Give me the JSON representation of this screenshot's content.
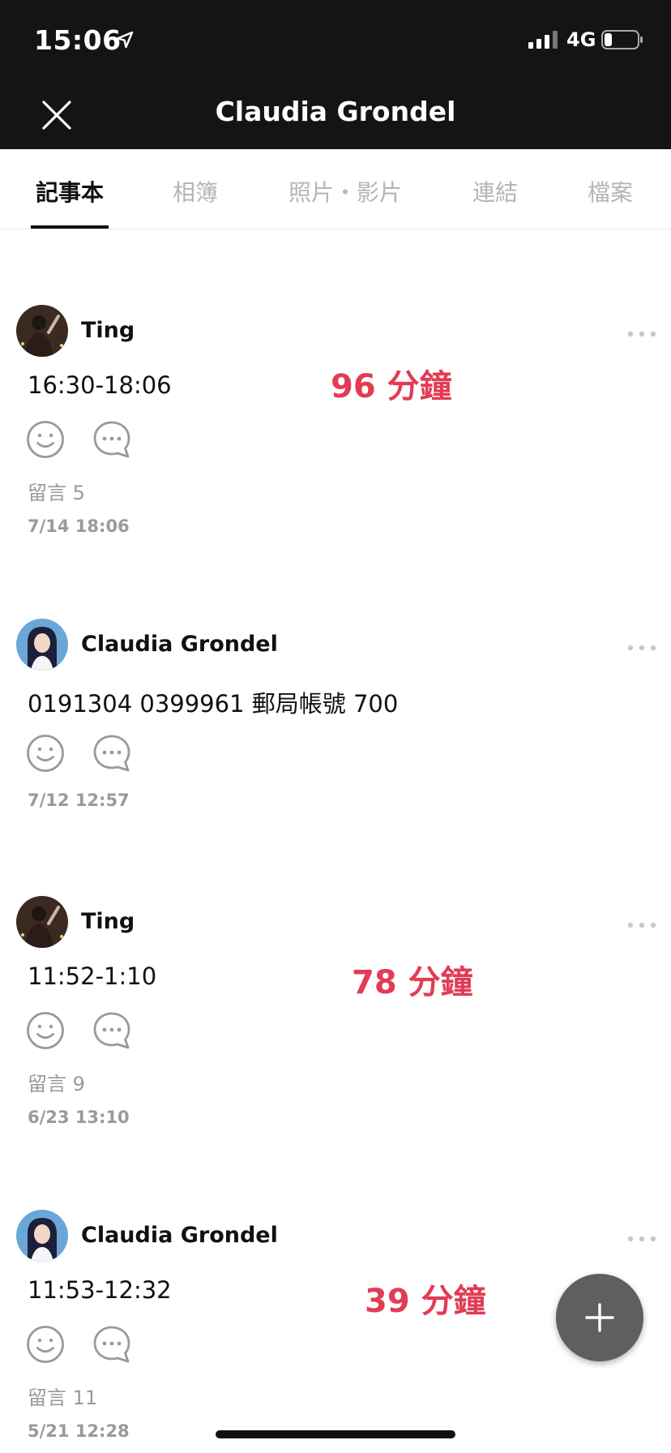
{
  "status_bar": {
    "time": "15:06",
    "network": "4G"
  },
  "header": {
    "title": "Claudia Grondel"
  },
  "tabs": [
    {
      "label": "記事本",
      "active": true
    },
    {
      "label": "相簿",
      "active": false
    },
    {
      "label": "照片・影片",
      "active": false
    },
    {
      "label": "連結",
      "active": false
    },
    {
      "label": "檔案",
      "active": false
    }
  ],
  "posts": [
    {
      "author": "Ting",
      "text": "16:30-18:06",
      "annotation": "96 分鐘",
      "comments": "留言 5",
      "timestamp": "7/14 18:06"
    },
    {
      "author": "Claudia Grondel",
      "text": "0191304  0399961 郵局帳號 700",
      "timestamp": "7/12 12:57"
    },
    {
      "author": "Ting",
      "text": "11:52-1:10",
      "annotation": "78 分鐘",
      "comments": "留言 9",
      "timestamp": "6/23 13:10"
    },
    {
      "author": "Claudia Grondel",
      "text": "11:53-12:32",
      "annotation": "39 分鐘",
      "comments": "留言 11",
      "timestamp": "5/21 12:28"
    }
  ],
  "colors": {
    "header_bg": "#141414",
    "annotation": "#e23c55",
    "fab": "#5f5f5f",
    "muted": "#9a9a9a"
  },
  "icons": [
    "location-arrow-icon",
    "signal-icon",
    "battery-icon",
    "close-icon",
    "more-icon",
    "smiley-icon",
    "comment-bubble-icon",
    "plus-icon"
  ]
}
